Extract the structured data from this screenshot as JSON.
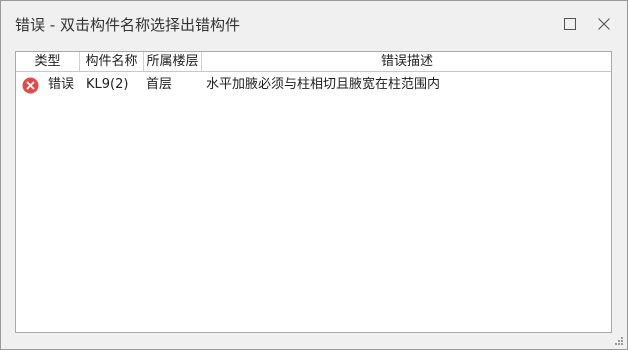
{
  "window": {
    "title": "错误 - 双击构件名称选择出错构件"
  },
  "controls": {
    "maximize_icon": "maximize-icon",
    "close_icon": "close-icon"
  },
  "table": {
    "headers": [
      "类型",
      "构件名称",
      "所属楼层",
      "错误描述"
    ],
    "rows": [
      {
        "icon": "error-icon",
        "type": "错误",
        "name": "KL9(2)",
        "floor": "首层",
        "description": "水平加腋必须与柱相切且腋宽在柱范围内"
      }
    ]
  },
  "colors": {
    "error_icon": "#e04a4a",
    "window_bg": "#f0f0f0",
    "panel_bg": "#ffffff"
  }
}
